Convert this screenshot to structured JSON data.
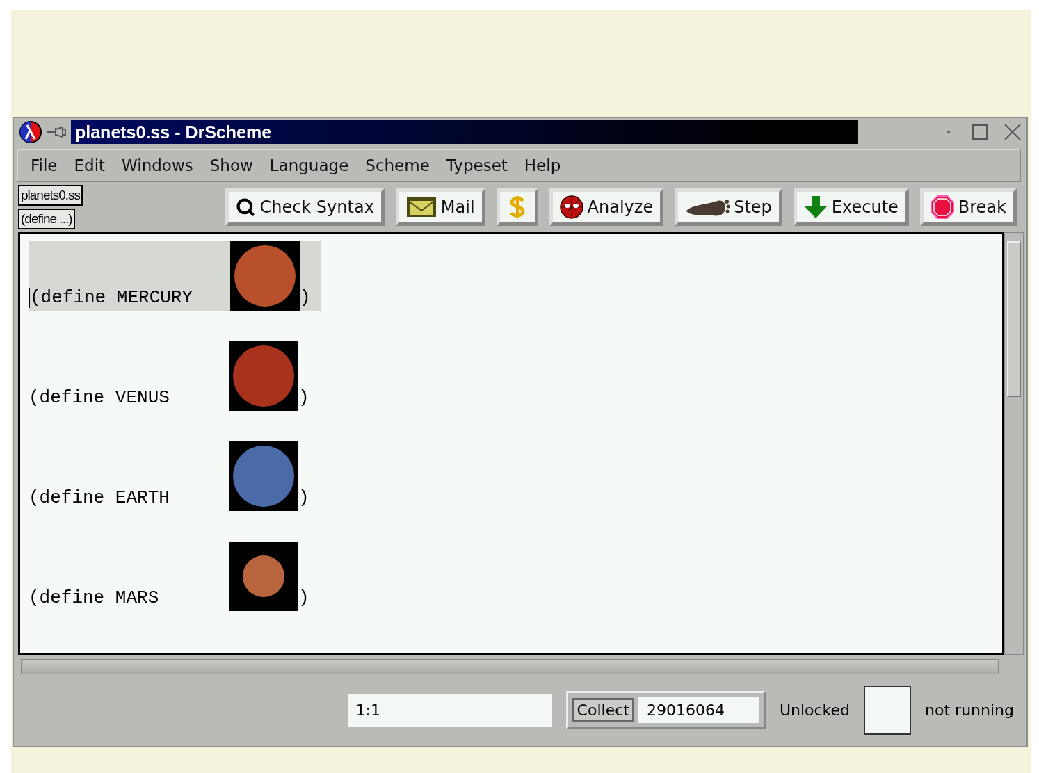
{
  "window": {
    "title": "planets0.ss - DrScheme"
  },
  "menu": [
    "File",
    "Edit",
    "Windows",
    "Show",
    "Language",
    "Scheme",
    "Typeset",
    "Help"
  ],
  "popups": [
    "planets0.ss",
    "(define ...)"
  ],
  "toolbar": [
    {
      "kind": "search",
      "label": "Check Syntax"
    },
    {
      "kind": "mail",
      "label": "Mail"
    },
    {
      "kind": "money"
    },
    {
      "kind": "analyze",
      "label": "Analyze"
    },
    {
      "kind": "step",
      "label": "Step"
    },
    {
      "kind": "execute",
      "label": "Execute"
    },
    {
      "kind": "break",
      "label": "Break"
    }
  ],
  "editor": {
    "lines": [
      {
        "code": "(define MERCURY",
        "close": ")",
        "highlighted": true,
        "caret": true,
        "color": "#b8502c"
      },
      {
        "code": "(define VENUS",
        "close": ")",
        "highlighted": false,
        "caret": false,
        "color": "#a8321c"
      },
      {
        "code": "(define EARTH",
        "close": ")",
        "highlighted": false,
        "caret": false,
        "color": "#4a6aa8"
      },
      {
        "code": "(define MARS",
        "close": ")",
        "highlighted": false,
        "caret": false,
        "color": "#b8643c"
      }
    ]
  },
  "status": {
    "position": "1:1",
    "collect_button": "Collect",
    "memory": "29016064",
    "lock": "Unlocked",
    "state": "not running"
  }
}
